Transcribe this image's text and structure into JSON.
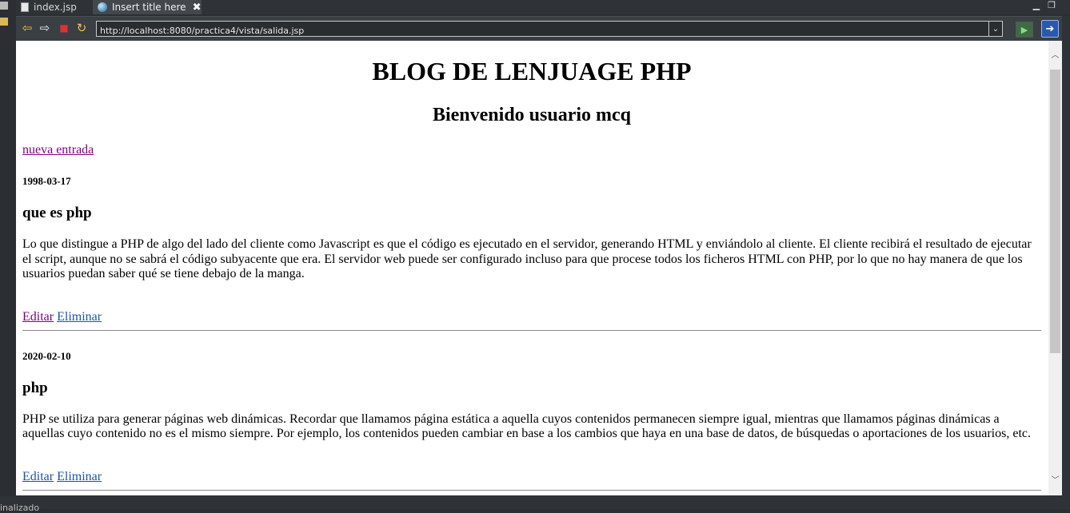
{
  "tabs": [
    {
      "label": "index.jsp",
      "icon": "jsp-file-icon"
    },
    {
      "label": "Insert title here",
      "icon": "globe-icon",
      "active": true,
      "close": "✖"
    }
  ],
  "toolbar": {
    "back_icon": "⇦",
    "forward_icon": "⇨",
    "stop_icon": "■",
    "refresh_icon": "↻",
    "url": "http://localhost:8080/practica4/vista/salida.jsp",
    "dropdown_icon": "⌄",
    "go_icon": "▶",
    "open_icon": "➔"
  },
  "page": {
    "title": "BLOG DE LENJUAGE PHP",
    "welcome": "Bienvenido usuario mcq",
    "new_entry_link": "nueva entrada",
    "entries": [
      {
        "date": "1998-03-17",
        "title": "que es php",
        "body": "Lo que distingue a PHP de algo del lado del cliente como Javascript es que el código es ejecutado en el servidor, generando HTML y enviándolo al cliente. El cliente recibirá el resultado de ejecutar el script, aunque no se sabrá el código subyacente que era. El servidor web puede ser configurado incluso para que procese todos los ficheros HTML con PHP, por lo que no hay manera de que los usuarios puedan saber qué se tiene debajo de la manga.",
        "edit_label": "Editar",
        "delete_label": "Eliminar"
      },
      {
        "date": "2020-02-10",
        "title": "php",
        "body": "PHP se utiliza para generar páginas web dinámicas. Recordar que llamamos página estática a aquella cuyos contenidos permanecen siempre igual, mientras que llamamos páginas dinámicas a aquellas cuyo contenido no es el mismo siempre. Por ejemplo, los contenidos pueden cambiar en base a los cambios que haya en una base de datos, de búsquedas o aportaciones de los usuarios, etc.",
        "edit_label": "Editar",
        "delete_label": "Eliminar"
      }
    ]
  },
  "status": {
    "text": "inalizado"
  },
  "colors": {
    "visited_link": "#800080",
    "link": "#1a56a6",
    "ide_background": "#2b2f33"
  }
}
